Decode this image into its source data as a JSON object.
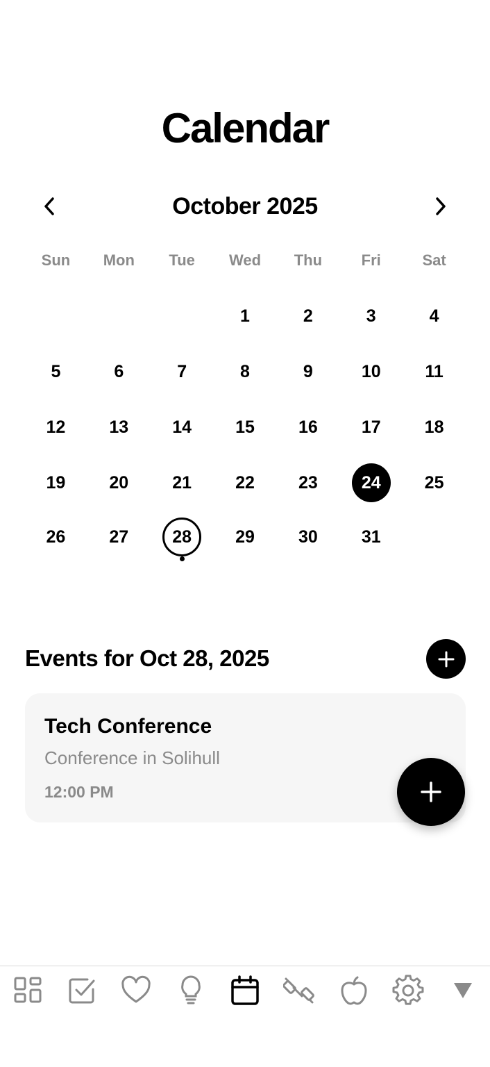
{
  "header": {
    "title": "Calendar"
  },
  "month_nav": {
    "label": "October 2025",
    "prev_icon": "chevron-left-icon",
    "next_icon": "chevron-right-icon"
  },
  "weekdays": [
    "Sun",
    "Mon",
    "Tue",
    "Wed",
    "Thu",
    "Fri",
    "Sat"
  ],
  "calendar": {
    "weeks": [
      [
        "",
        "",
        "",
        "1",
        "2",
        "3",
        "4"
      ],
      [
        "5",
        "6",
        "7",
        "8",
        "9",
        "10",
        "11"
      ],
      [
        "12",
        "13",
        "14",
        "15",
        "16",
        "17",
        "18"
      ],
      [
        "19",
        "20",
        "21",
        "22",
        "23",
        "24",
        "25"
      ],
      [
        "26",
        "27",
        "28",
        "29",
        "30",
        "31",
        ""
      ]
    ],
    "selected_day": "24",
    "highlighted_day": "28",
    "days_with_events": [
      "28"
    ]
  },
  "events": {
    "header": "Events for Oct 28, 2025",
    "add_icon": "plus-icon",
    "items": [
      {
        "title": "Tech Conference",
        "subtitle": "Conference in Solihull",
        "time": "12:00 PM"
      }
    ]
  },
  "fab": {
    "icon": "plus-icon"
  },
  "bottom_nav": {
    "items": [
      {
        "name": "dashboard",
        "icon": "grid-icon",
        "active": false
      },
      {
        "name": "tasks",
        "icon": "checkbox-icon",
        "active": false
      },
      {
        "name": "favorites",
        "icon": "heart-icon",
        "active": false
      },
      {
        "name": "ideas",
        "icon": "lightbulb-icon",
        "active": false
      },
      {
        "name": "calendar",
        "icon": "calendar-icon",
        "active": true
      },
      {
        "name": "fitness",
        "icon": "dumbbell-icon",
        "active": false
      },
      {
        "name": "nutrition",
        "icon": "apple-icon",
        "active": false
      },
      {
        "name": "settings",
        "icon": "gear-icon",
        "active": false
      },
      {
        "name": "more",
        "icon": "triangle-down-icon",
        "active": false
      }
    ],
    "active_color": "#000000",
    "inactive_color": "#8a8a8a"
  }
}
